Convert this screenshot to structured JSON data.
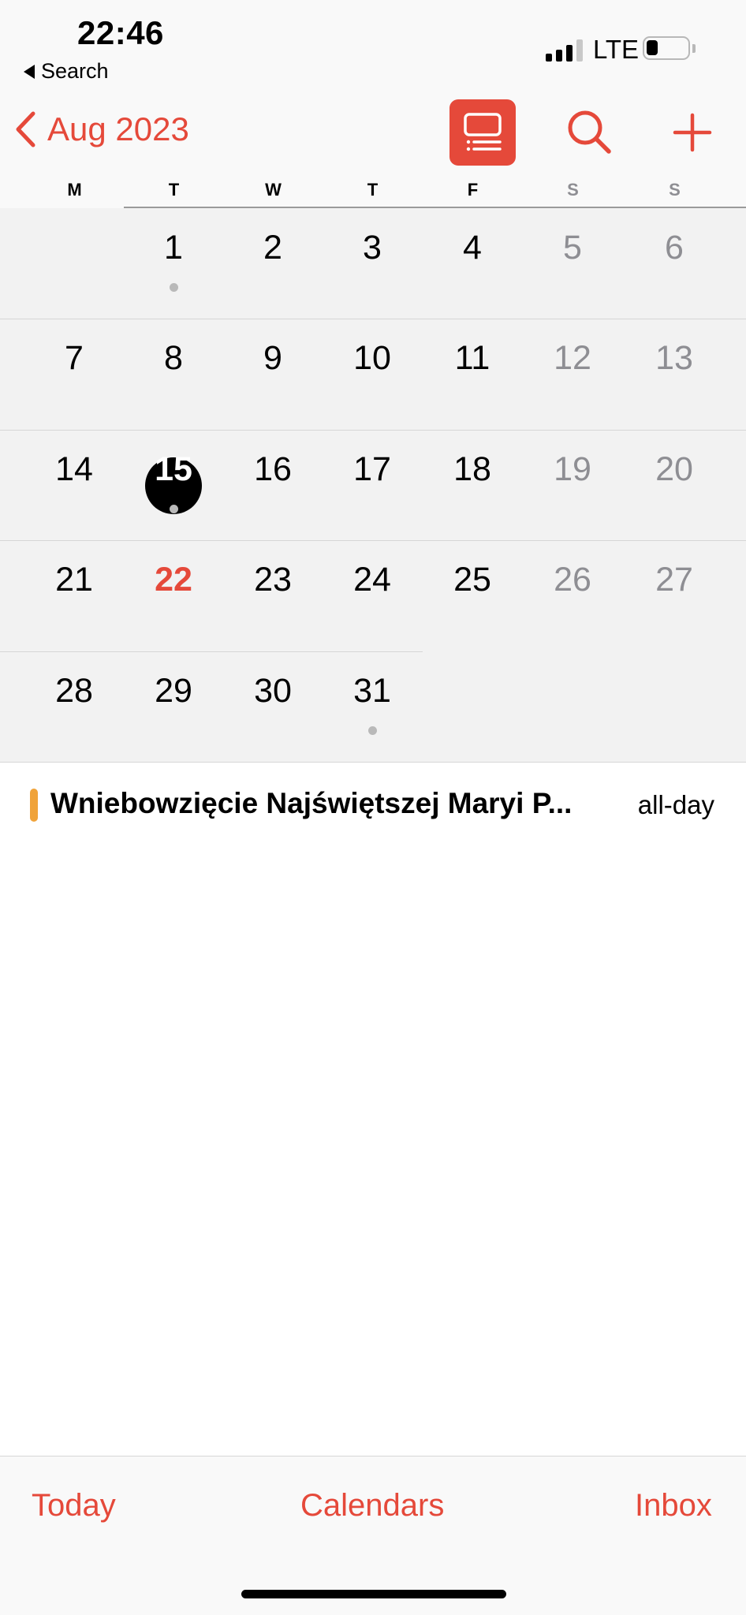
{
  "status_bar": {
    "time": "22:46",
    "back_app_label": "Search",
    "network": "LTE"
  },
  "nav": {
    "month_label": "Aug 2023",
    "icons": {
      "back": "chevron-left-icon",
      "list": "list-view-icon",
      "search": "search-icon",
      "add": "plus-icon"
    }
  },
  "weekdays": [
    "M",
    "T",
    "W",
    "T",
    "F",
    "S",
    "S"
  ],
  "calendar": {
    "month": "August 2023",
    "weeks": [
      [
        "",
        "1",
        "2",
        "3",
        "4",
        "5",
        "6"
      ],
      [
        "7",
        "8",
        "9",
        "10",
        "11",
        "12",
        "13"
      ],
      [
        "14",
        "15",
        "16",
        "17",
        "18",
        "19",
        "20"
      ],
      [
        "21",
        "22",
        "23",
        "24",
        "25",
        "26",
        "27"
      ],
      [
        "28",
        "29",
        "30",
        "31",
        "",
        "",
        ""
      ]
    ],
    "today": "22",
    "selected": "15",
    "days_with_events": [
      "1",
      "15",
      "31"
    ]
  },
  "events": [
    {
      "title": "Wniebowzięcie Najświętszej Maryi P...",
      "time": "all-day",
      "color": "#f0a33a"
    }
  ],
  "tabbar": {
    "today": "Today",
    "calendars": "Calendars",
    "inbox": "Inbox"
  },
  "colors": {
    "accent": "#e5493a",
    "weekend_text": "#8e8e93",
    "event_dot": "#b9b9b9"
  }
}
